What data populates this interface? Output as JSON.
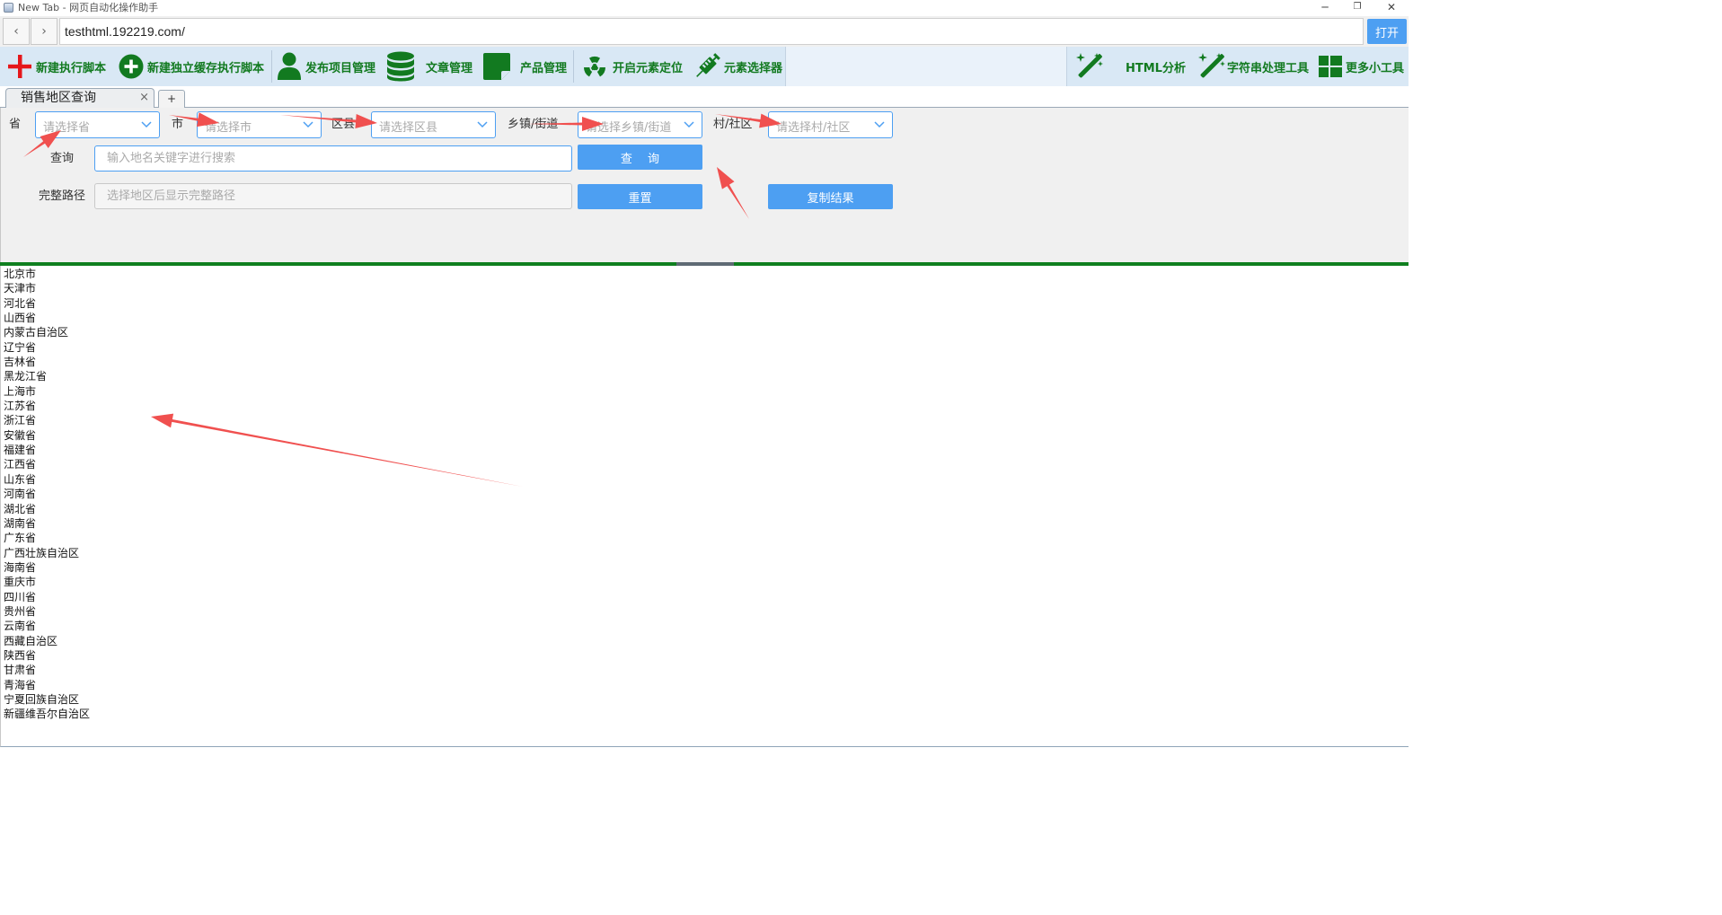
{
  "window": {
    "title": "New Tab - 网页自动化操作助手",
    "minimize": "─",
    "restore": "❐",
    "close": "✕"
  },
  "address": {
    "back": "‹",
    "forward": "›",
    "url": "testhtml.192219.com/",
    "open_label": "打开"
  },
  "toolbar": {
    "items": [
      {
        "label": "新建执行脚本",
        "icon": "plus-icon"
      },
      {
        "label": "新建独立缓存执行脚本",
        "icon": "plus-circle-icon"
      },
      {
        "label": "发布项目管理",
        "icon": "user-icon"
      },
      {
        "label": "文章管理",
        "icon": "database-icon"
      },
      {
        "label": "产品管理",
        "icon": "note-icon"
      },
      {
        "label": "开启元素定位",
        "icon": "radiation-icon"
      },
      {
        "label": "元素选择器",
        "icon": "syringe-icon"
      },
      {
        "label": "HTML分析",
        "icon": "magic-wand-icon"
      },
      {
        "label": "字符串处理工具",
        "icon": "magic-wand-icon"
      },
      {
        "label": "更多小工具",
        "icon": "grid-icon"
      }
    ],
    "color": "#127a20"
  },
  "tabs": {
    "active_label": "销售地区查询",
    "close": "×",
    "add": "+"
  },
  "form": {
    "province_label": "省",
    "province_placeholder": "请选择省",
    "city_label": "市",
    "city_placeholder": "请选择市",
    "district_label": "区县",
    "district_placeholder": "请选择区县",
    "town_label": "乡镇/街道",
    "town_placeholder": "请选择乡镇/街道",
    "village_label": "村/社区",
    "village_placeholder": "请选择村/社区",
    "query_label": "查询",
    "query_placeholder": "输入地名关键字进行搜索",
    "query_button": "查　 询",
    "path_label": "完整路径",
    "path_placeholder": "选择地区后显示完整路径",
    "reset_button": "重置",
    "copy_button": "复制结果",
    "accent": "#4d9ff2"
  },
  "results": [
    "北京市",
    "天津市",
    "河北省",
    "山西省",
    "内蒙古自治区",
    "辽宁省",
    "吉林省",
    "黑龙江省",
    "上海市",
    "江苏省",
    "浙江省",
    "安徽省",
    "福建省",
    "江西省",
    "山东省",
    "河南省",
    "湖北省",
    "湖南省",
    "广东省",
    "广西壮族自治区",
    "海南省",
    "重庆市",
    "四川省",
    "贵州省",
    "云南省",
    "西藏自治区",
    "陕西省",
    "甘肃省",
    "青海省",
    "宁夏回族自治区",
    "新疆维吾尔自治区"
  ],
  "annotation_color": "#f0504f"
}
